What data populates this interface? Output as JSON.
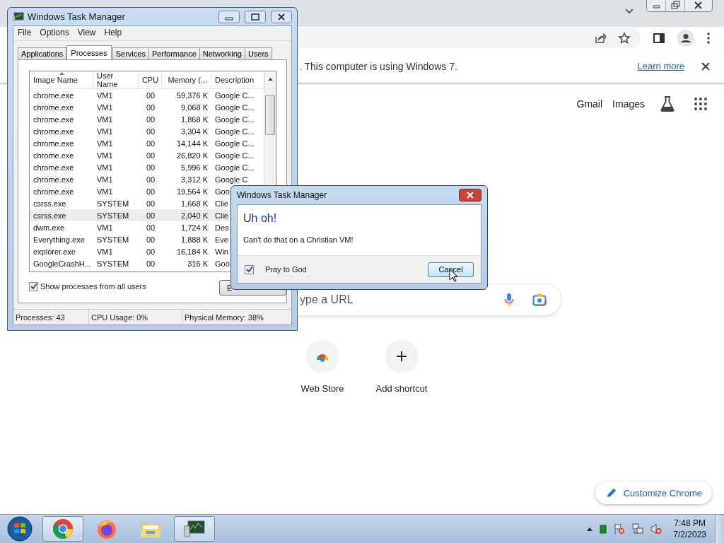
{
  "browser": {
    "infobar": {
      "message": ". This computer is using Windows 7.",
      "link": "Learn more"
    },
    "header_links": [
      "Gmail",
      "Images"
    ],
    "search": {
      "placeholder": "ype a URL"
    },
    "shortcuts": [
      {
        "kind": "store",
        "label": "Web Store"
      },
      {
        "kind": "add",
        "label": "Add shortcut"
      }
    ],
    "customize_button": "Customize Chrome"
  },
  "task_manager": {
    "title": "Windows Task Manager",
    "menu": [
      "File",
      "Options",
      "View",
      "Help"
    ],
    "tabs": [
      {
        "label": "Applications",
        "selected": false
      },
      {
        "label": "Processes",
        "selected": true
      },
      {
        "label": "Services",
        "selected": false
      },
      {
        "label": "Performance",
        "selected": false
      },
      {
        "label": "Networking",
        "selected": false
      },
      {
        "label": "Users",
        "selected": false
      }
    ],
    "columns": [
      "Image Name",
      "User Name",
      "CPU",
      "Memory (...",
      "Description"
    ],
    "rows": [
      {
        "cells": [
          "chrome.exe",
          "VM1",
          "00",
          "59,376 K",
          "Google C..."
        ],
        "selected": false
      },
      {
        "cells": [
          "chrome.exe",
          "VM1",
          "00",
          "9,068 K",
          "Google C..."
        ],
        "selected": false
      },
      {
        "cells": [
          "chrome.exe",
          "VM1",
          "00",
          "1,868 K",
          "Google C..."
        ],
        "selected": false
      },
      {
        "cells": [
          "chrome.exe",
          "VM1",
          "00",
          "3,304 K",
          "Google C..."
        ],
        "selected": false
      },
      {
        "cells": [
          "chrome.exe",
          "VM1",
          "00",
          "14,144 K",
          "Google C..."
        ],
        "selected": false
      },
      {
        "cells": [
          "chrome.exe",
          "VM1",
          "00",
          "26,820 K",
          "Google C..."
        ],
        "selected": false
      },
      {
        "cells": [
          "chrome.exe",
          "VM1",
          "00",
          "5,996 K",
          "Google C..."
        ],
        "selected": false
      },
      {
        "cells": [
          "chrome.exe",
          "VM1",
          "00",
          "3,312 K",
          "Google C"
        ],
        "selected": false
      },
      {
        "cells": [
          "chrome.exe",
          "VM1",
          "00",
          "19,564 K",
          "Goo"
        ],
        "selected": false
      },
      {
        "cells": [
          "csrss.exe",
          "SYSTEM",
          "00",
          "1,668 K",
          "Clie"
        ],
        "selected": false
      },
      {
        "cells": [
          "csrss.exe",
          "SYSTEM",
          "00",
          "2,040 K",
          "Clie"
        ],
        "selected": true
      },
      {
        "cells": [
          "dwm.exe",
          "VM1",
          "00",
          "1,724 K",
          "Des"
        ],
        "selected": false
      },
      {
        "cells": [
          "Everything.exe",
          "SYSTEM",
          "00",
          "1,888 K",
          "Eve"
        ],
        "selected": false
      },
      {
        "cells": [
          "explorer.exe",
          "VM1",
          "00",
          "16,184 K",
          "Win"
        ],
        "selected": false
      },
      {
        "cells": [
          "GoogleCrashH...",
          "SYSTEM",
          "00",
          "316 K",
          "Goo"
        ],
        "selected": false
      }
    ],
    "show_all_users": {
      "label": "Show processes from all users",
      "checked": true
    },
    "end_button": "E",
    "status": [
      "Processes: 43",
      "CPU Usage: 0%",
      "Physical Memory: 38%"
    ]
  },
  "dialog": {
    "title": "Windows Task Manager",
    "heading": "Uh oh!",
    "message": "Can't do that on a Christian VM!",
    "checkbox": {
      "label": "Pray to God",
      "checked": true
    },
    "button": "Cancel"
  },
  "taskbar": {
    "apps": [
      {
        "kind": "chrome",
        "running": true
      },
      {
        "kind": "firefox",
        "running": false
      },
      {
        "kind": "folder",
        "running": false
      },
      {
        "kind": "monitor",
        "running": true
      }
    ],
    "clock": {
      "time": "7:48 PM",
      "date": "7/2/2023"
    }
  }
}
